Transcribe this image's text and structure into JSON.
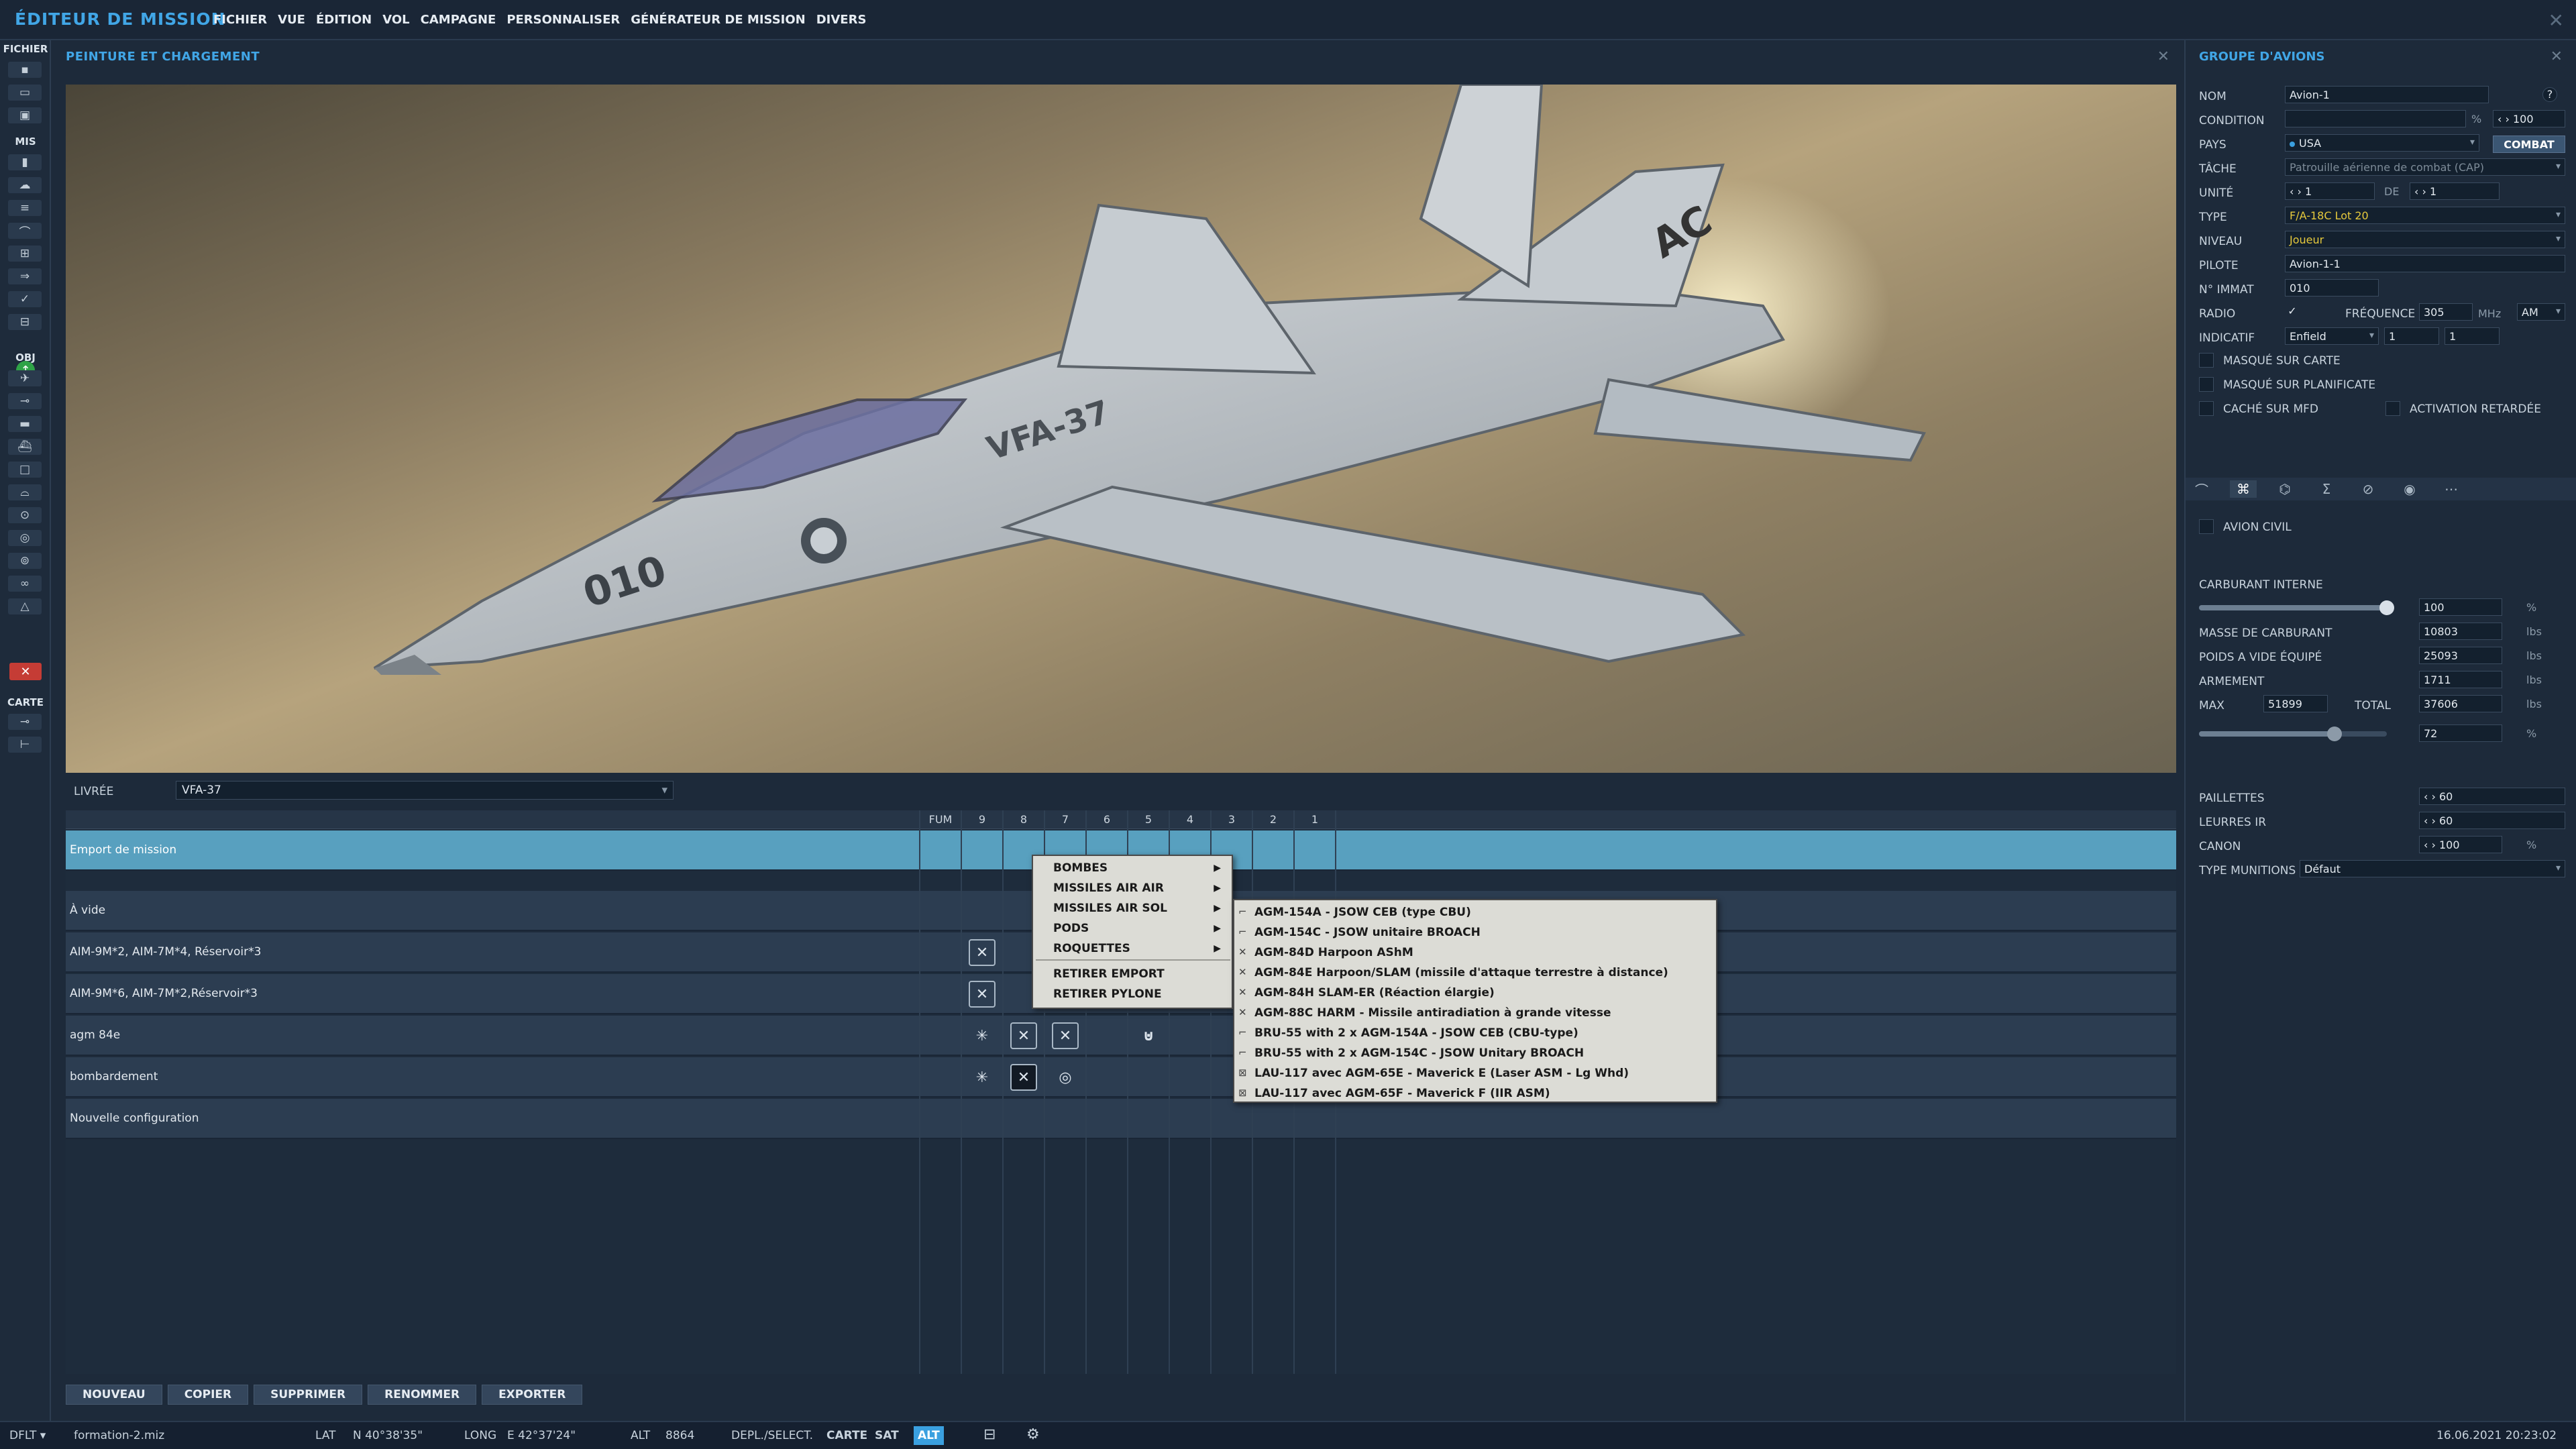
{
  "app": {
    "title": "ÉDITEUR DE MISSION",
    "menu": [
      "FICHIER",
      "VUE",
      "ÉDITION",
      "VOL",
      "CAMPAGNE",
      "PERSONNALISER",
      "GÉNÉRATEUR DE MISSION",
      "DIVERS"
    ]
  },
  "toolbar": {
    "sections": [
      "FICHIER",
      "MIS",
      "OBJ",
      "CARTE"
    ]
  },
  "panel": {
    "title": "PEINTURE ET CHARGEMENT",
    "livery_label": "LIVRÉE",
    "livery_value": "VFA-37",
    "columns": [
      "FUM",
      "9",
      "8",
      "7",
      "6",
      "5",
      "4",
      "3",
      "2",
      "1"
    ],
    "rows": [
      {
        "label": "Emport de mission",
        "selected": true
      },
      {
        "label": "À vide"
      },
      {
        "label": "AIM-9M*2, AIM-7M*4, Réservoir*3"
      },
      {
        "label": "AIM-9M*6, AIM-7M*2,Réservoir*3"
      },
      {
        "label": "agm 84e"
      },
      {
        "label": "bombardement"
      },
      {
        "label": "Nouvelle configuration"
      }
    ],
    "buttons": [
      "NOUVEAU",
      "COPIER",
      "SUPPRIMER",
      "RENOMMER",
      "EXPORTER"
    ]
  },
  "context_menu": {
    "items": [
      "BOMBES",
      "MISSILES AIR AIR",
      "MISSILES AIR SOL",
      "PODS",
      "ROQUETTES"
    ],
    "actions": [
      "RETIRER EMPORT",
      "RETIRER PYLONE"
    ],
    "submenu": [
      "AGM-154A - JSOW CEB (type CBU)",
      "AGM-154C - JSOW unitaire BROACH",
      "AGM-84D Harpoon AShM",
      "AGM-84E Harpoon/SLAM (missile d'attaque terrestre à distance)",
      "AGM-84H SLAM-ER (Réaction élargie)",
      "AGM-88C HARM - Missile antiradiation à grande vitesse",
      "BRU-55 with 2 x AGM-154A - JSOW CEB (CBU-type)",
      "BRU-55 with 2 x AGM-154C - JSOW Unitary BROACH",
      "LAU-117 avec AGM-65E - Maverick E (Laser ASM - Lg Whd)",
      "LAU-117 avec AGM-65F - Maverick F (IIR ASM)"
    ]
  },
  "group": {
    "title": "GROUPE D'AVIONS",
    "nom_label": "NOM",
    "nom": "Avion-1",
    "help": "?",
    "condition_label": "CONDITION",
    "condition_pct": "%",
    "condition_value": "100",
    "pays_label": "PAYS",
    "pays": "USA",
    "combat": "COMBAT",
    "tache_label": "TÂCHE",
    "tache": "Patrouille aérienne de combat (CAP)",
    "unite_label": "UNITÉ",
    "unite_value": "1",
    "de_label": "DE",
    "unite_total": "1",
    "type_label": "TYPE",
    "type": "F/A-18C Lot 20",
    "niveau_label": "NIVEAU",
    "niveau": "Joueur",
    "pilote_label": "PILOTE",
    "pilote": "Avion-1-1",
    "immat_label": "N° IMMAT",
    "immat": "010",
    "radio_label": "RADIO",
    "frequence_label": "FRÉQUENCE",
    "frequence": "305",
    "mhz": "MHz",
    "modulation": "AM",
    "indicatif_label": "INDICATIF",
    "indicatif": "Enfield",
    "indicatif_n1": "1",
    "indicatif_n2": "1",
    "masque_carte": "MASQUÉ SUR CARTE",
    "masque_planif": "MASQUÉ SUR PLANIFICATE",
    "cache_mfd": "CACHÉ SUR MFD",
    "activation": "ACTIVATION RETARDÉE",
    "avion_civil": "AVION CIVIL",
    "carburant_label": "CARBURANT INTERNE",
    "carburant": "100",
    "carburant_unit": "%",
    "carburant_fraction": 1.0,
    "masse_label": "MASSE DE CARBURANT",
    "masse": "10803",
    "poids_label": "POIDS A VIDE ÉQUIPÉ",
    "poids": "25093",
    "armement_label": "ARMEMENT",
    "armement": "1711",
    "max_label": "MAX",
    "max": "51899",
    "total_label": "TOTAL",
    "total": "37606",
    "lbs": "lbs",
    "ratio": "72",
    "ratio_unit": "%",
    "ratio_fraction": 0.72,
    "paillettes_label": "PAILLETTES",
    "paillettes": "60",
    "leurres_label": "LEURRES IR",
    "leurres": "60",
    "canon_label": "CANON",
    "canon": "100",
    "canon_unit": "%",
    "munitions_label": "TYPE MUNITIONS",
    "munitions": "Défaut"
  },
  "status": {
    "mode": "DFLT",
    "file": "formation-2.miz",
    "lat_label": "LAT",
    "lat": "N 40°38'35\"",
    "long_label": "LONG",
    "long": "E 42°37'24\"",
    "alt_label": "ALT",
    "alt": "8864",
    "depl_label": "DEPL./SELECT.",
    "carte": "CARTE",
    "sat": "SAT",
    "alt_btn": "ALT",
    "datetime": "16.06.2021 20:23:02"
  }
}
